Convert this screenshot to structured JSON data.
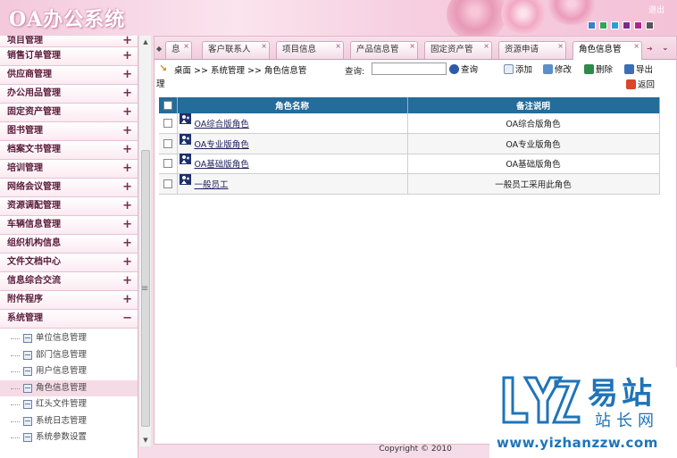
{
  "app": {
    "title": "OA办公系统",
    "logout_label": "退出",
    "theme_colors": [
      "#3b7fc4",
      "#33a457",
      "#2b9fd4",
      "#7a2a8a",
      "#b0268b",
      "#555555"
    ]
  },
  "sidebar": {
    "items": [
      {
        "label": "项目管理",
        "expander": "+"
      },
      {
        "label": "销售订单管理",
        "expander": "+"
      },
      {
        "label": "供应商管理",
        "expander": "+"
      },
      {
        "label": "办公用品管理",
        "expander": "+"
      },
      {
        "label": "固定资产管理",
        "expander": "+"
      },
      {
        "label": "图书管理",
        "expander": "+"
      },
      {
        "label": "档案文书管理",
        "expander": "+"
      },
      {
        "label": "培训管理",
        "expander": "+"
      },
      {
        "label": "网络会议管理",
        "expander": "+"
      },
      {
        "label": "资源调配管理",
        "expander": "+"
      },
      {
        "label": "车辆信息管理",
        "expander": "+"
      },
      {
        "label": "组织机构信息",
        "expander": "+"
      },
      {
        "label": "文件文档中心",
        "expander": "+"
      },
      {
        "label": "信息综合交流",
        "expander": "+"
      },
      {
        "label": "附件程序",
        "expander": "+"
      },
      {
        "label": "系统管理",
        "expander": "−"
      }
    ],
    "subitems": [
      {
        "label": "单位信息管理"
      },
      {
        "label": "部门信息管理"
      },
      {
        "label": "用户信息管理"
      },
      {
        "label": "角色信息管理"
      },
      {
        "label": "红头文件管理"
      },
      {
        "label": "系统日志管理"
      },
      {
        "label": "系统参数设置"
      }
    ],
    "splitter_glyph": "≡"
  },
  "tabs": [
    {
      "label": "息"
    },
    {
      "label": "客户联系人"
    },
    {
      "label": "项目信息"
    },
    {
      "label": "产品信息管"
    },
    {
      "label": "固定资产管"
    },
    {
      "label": "资源申请"
    },
    {
      "label": "角色信息管"
    }
  ],
  "tab_close": "×",
  "toolbar": {
    "breadcrumb": "桌面 >> 系统管理 >> 角色信息管",
    "breadcrumb_wrap": "理",
    "query_label": "查询:",
    "query_value": "",
    "search_label": "查询",
    "add_label": "添加",
    "edit_label": "修改",
    "delete_label": "删除",
    "export_label": "导出",
    "back_label": "返回"
  },
  "grid": {
    "headers": [
      "角色名称",
      "备注说明"
    ],
    "rows": [
      {
        "name": "OA综合版角色",
        "remark": "OA综合版角色"
      },
      {
        "name": "OA专业版角色",
        "remark": "OA专业版角色"
      },
      {
        "name": "OA基础版角色",
        "remark": "OA基础版角色"
      },
      {
        "name": "一般员工",
        "remark": "一般员工采用此角色"
      }
    ]
  },
  "footer": {
    "copyright": "Copyright © 2010"
  },
  "watermark": {
    "cn_big": "易站",
    "cn_small": "站长网",
    "url": "www.yizhanzzw.com"
  }
}
